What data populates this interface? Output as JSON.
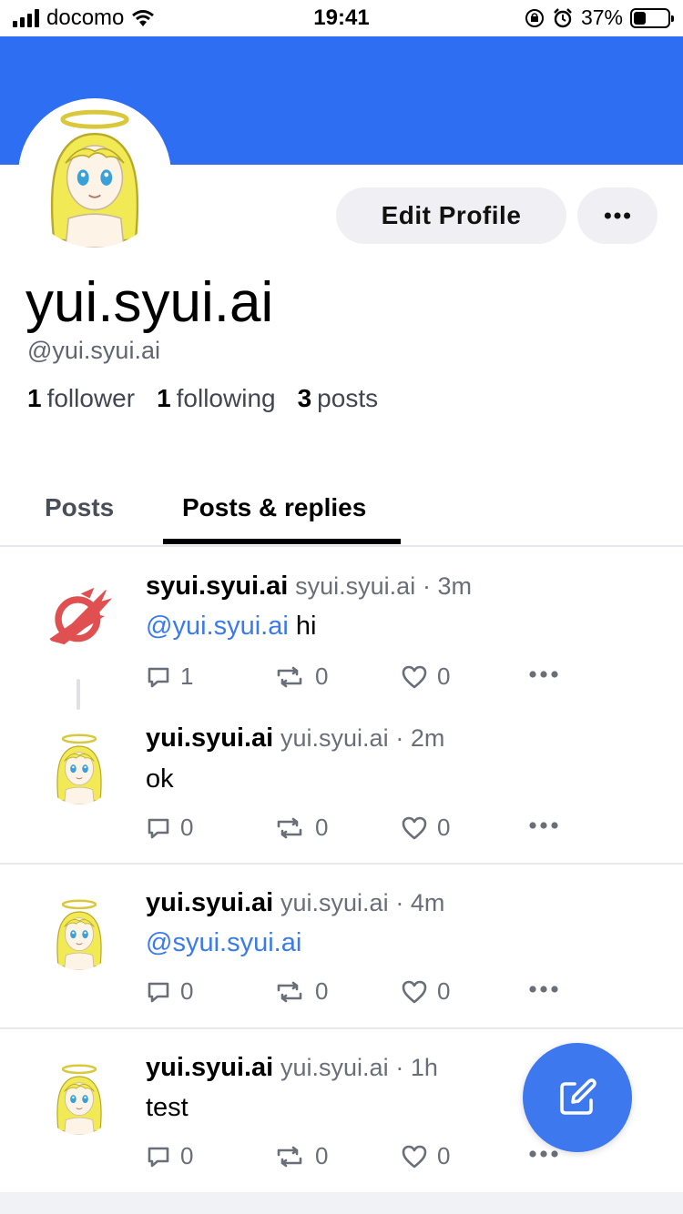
{
  "status_bar": {
    "carrier": "docomo",
    "time": "19:41",
    "battery_percent": "37%",
    "battery_level": 0.37
  },
  "colors": {
    "banner": "#2e6ef2",
    "accent": "#3a7bec",
    "fab": "#3d78ef"
  },
  "profile": {
    "display_name": "yui.syui.ai",
    "handle": "@yui.syui.ai",
    "edit_button": "Edit Profile",
    "stats": [
      {
        "count": "1",
        "label": "follower"
      },
      {
        "count": "1",
        "label": "following"
      },
      {
        "count": "3",
        "label": "posts"
      }
    ]
  },
  "tabs": [
    {
      "label": "Posts",
      "active": false
    },
    {
      "label": "Posts & replies",
      "active": true
    }
  ],
  "posts": [
    {
      "display_name": "syui.syui.ai",
      "handle": "syui.syui.ai",
      "time": "· 3m",
      "mention": "@yui.syui.ai",
      "text": " hi",
      "replies": "1",
      "reposts": "0",
      "likes": "0",
      "avatar": "phoenix-icon"
    },
    {
      "display_name": "yui.syui.ai",
      "handle": "yui.syui.ai",
      "time": "· 2m",
      "mention": "",
      "text": "ok",
      "replies": "0",
      "reposts": "0",
      "likes": "0",
      "avatar": "angel-avatar"
    },
    {
      "display_name": "yui.syui.ai",
      "handle": "yui.syui.ai",
      "time": "· 4m",
      "mention": "@syui.syui.ai",
      "text": "",
      "replies": "0",
      "reposts": "0",
      "likes": "0",
      "avatar": "angel-avatar"
    },
    {
      "display_name": "yui.syui.ai",
      "handle": "yui.syui.ai",
      "time": "· 1h",
      "mention": "",
      "text": "test",
      "replies": "0",
      "reposts": "0",
      "likes": "0",
      "avatar": "angel-avatar"
    }
  ]
}
